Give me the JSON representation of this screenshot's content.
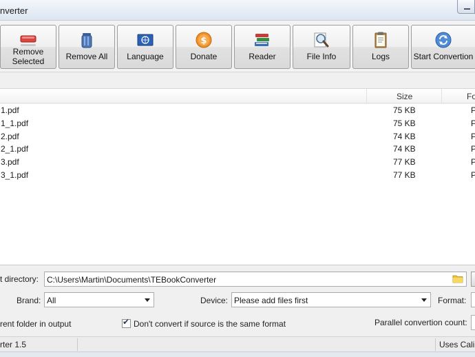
{
  "window": {
    "title": "nverter",
    "status_left": "rter 1.5",
    "status_right": "Uses Cali"
  },
  "toolbar": {
    "buttons": [
      {
        "id": "remove-selected",
        "label": "Remove Selected",
        "icon": "remove-selected-icon"
      },
      {
        "id": "remove-all",
        "label": "Remove All",
        "icon": "trash-can-icon"
      },
      {
        "id": "language",
        "label": "Language",
        "icon": "un-flag-icon"
      },
      {
        "id": "donate",
        "label": "Donate",
        "icon": "coin-icon"
      },
      {
        "id": "reader",
        "label": "Reader",
        "icon": "book-stack-icon"
      },
      {
        "id": "file-info",
        "label": "File Info",
        "icon": "magnifier-icon"
      },
      {
        "id": "logs",
        "label": "Logs",
        "icon": "clipboard-icon"
      },
      {
        "id": "start-conversion",
        "label": "Start Convertion",
        "icon": "refresh-icon"
      }
    ]
  },
  "file_list": {
    "columns": [
      "Size",
      "Fo"
    ],
    "rows": [
      {
        "name": "1.pdf",
        "size": "75 KB",
        "format": "P"
      },
      {
        "name": "1_1.pdf",
        "size": "75 KB",
        "format": "P"
      },
      {
        "name": "2.pdf",
        "size": "74 KB",
        "format": "P"
      },
      {
        "name": "2_1.pdf",
        "size": "74 KB",
        "format": "P"
      },
      {
        "name": "3.pdf",
        "size": "77 KB",
        "format": "P"
      },
      {
        "name": "3_1.pdf",
        "size": "77 KB",
        "format": "P"
      }
    ]
  },
  "options": {
    "output_directory_label": "t directory:",
    "output_directory_value": "C:\\Users\\Martin\\Documents\\TEBookConverter",
    "brand_label": "Brand:",
    "brand_value": "All",
    "device_label": "Device:",
    "device_value": "Please add files first",
    "format_label": "Format:",
    "parent_folder_label": "rent folder in output",
    "dont_convert_label": "Don't convert if source is the same format",
    "dont_convert_checked": true,
    "parallel_label": "Parallel convertion count:"
  },
  "colors": {
    "accent_donate": "#f0912a",
    "remove_red": "#d9463f",
    "trash_blue": "#4f78b8"
  }
}
